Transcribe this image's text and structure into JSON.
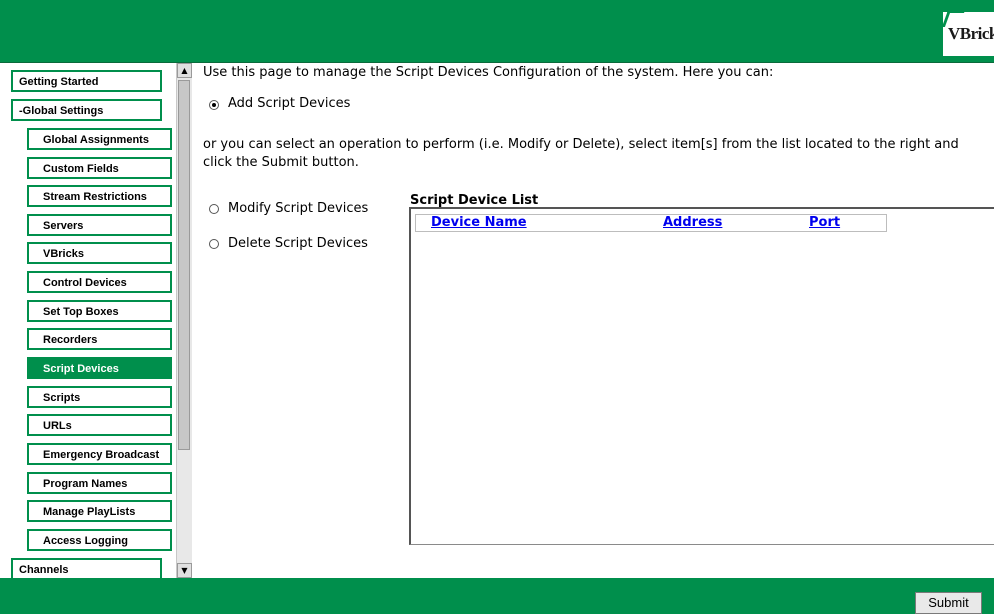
{
  "logo": {
    "text": "VBrick"
  },
  "sidebar": {
    "items": [
      {
        "label": "Getting Started",
        "level": "top"
      },
      {
        "label": "-Global Settings",
        "level": "top"
      },
      {
        "label": "Global Assignments",
        "level": "sub"
      },
      {
        "label": "Custom Fields",
        "level": "sub"
      },
      {
        "label": "Stream Restrictions",
        "level": "sub"
      },
      {
        "label": "Servers",
        "level": "sub"
      },
      {
        "label": "VBricks",
        "level": "sub"
      },
      {
        "label": "Control Devices",
        "level": "sub"
      },
      {
        "label": "Set Top Boxes",
        "level": "sub"
      },
      {
        "label": "Recorders",
        "level": "sub"
      },
      {
        "label": "Script Devices",
        "level": "sub",
        "active": true
      },
      {
        "label": "Scripts",
        "level": "sub"
      },
      {
        "label": "URLs",
        "level": "sub"
      },
      {
        "label": "Emergency Broadcast",
        "level": "sub"
      },
      {
        "label": "Program Names",
        "level": "sub"
      },
      {
        "label": "Manage PlayLists",
        "level": "sub"
      },
      {
        "label": "Access Logging",
        "level": "sub"
      },
      {
        "label": "Channels",
        "level": "top"
      }
    ]
  },
  "main": {
    "intro": "Use this page to manage the Script Devices Configuration of the system. Here you can:",
    "add_option": "Add Script Devices",
    "instructions_line1": "or you can select an operation to perform (i.e. Modify or Delete), select item[s] from the list located to the right and",
    "instructions_line2": "click the Submit button.",
    "modify_option": "Modify Script Devices",
    "delete_option": "Delete Script Devices",
    "list_title": "Script Device List",
    "columns": [
      "Device Name",
      "Address",
      "Port"
    ]
  },
  "footer": {
    "submit_label": "Submit"
  },
  "colors": {
    "brand_green": "#008f4c"
  }
}
